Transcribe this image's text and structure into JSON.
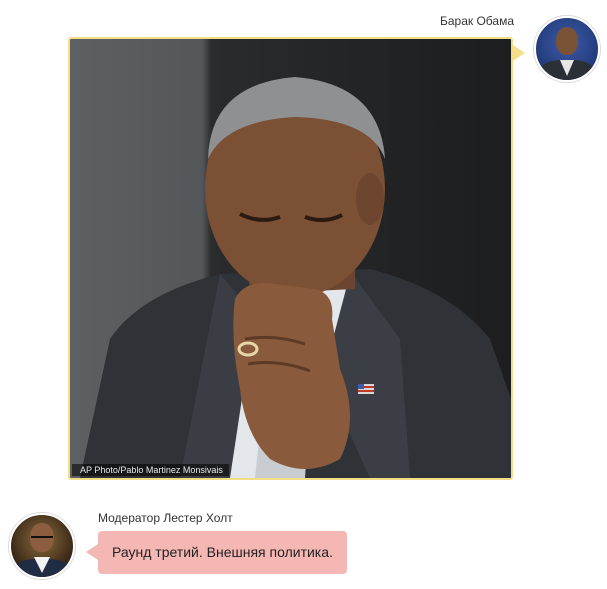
{
  "messages": [
    {
      "sender": "Барак Обама",
      "side": "right",
      "avatar_icon": "obama-avatar",
      "bubble_color": "#f3dd86",
      "photo": {
        "credit": "AP Photo/Pablo Martinez Monsivais"
      }
    },
    {
      "sender": "Модератор Лестер Холт",
      "side": "left",
      "avatar_icon": "lester-holt-avatar",
      "bubble_color": "#f5b7b3",
      "text": "Раунд третий. Внешняя политика."
    }
  ]
}
